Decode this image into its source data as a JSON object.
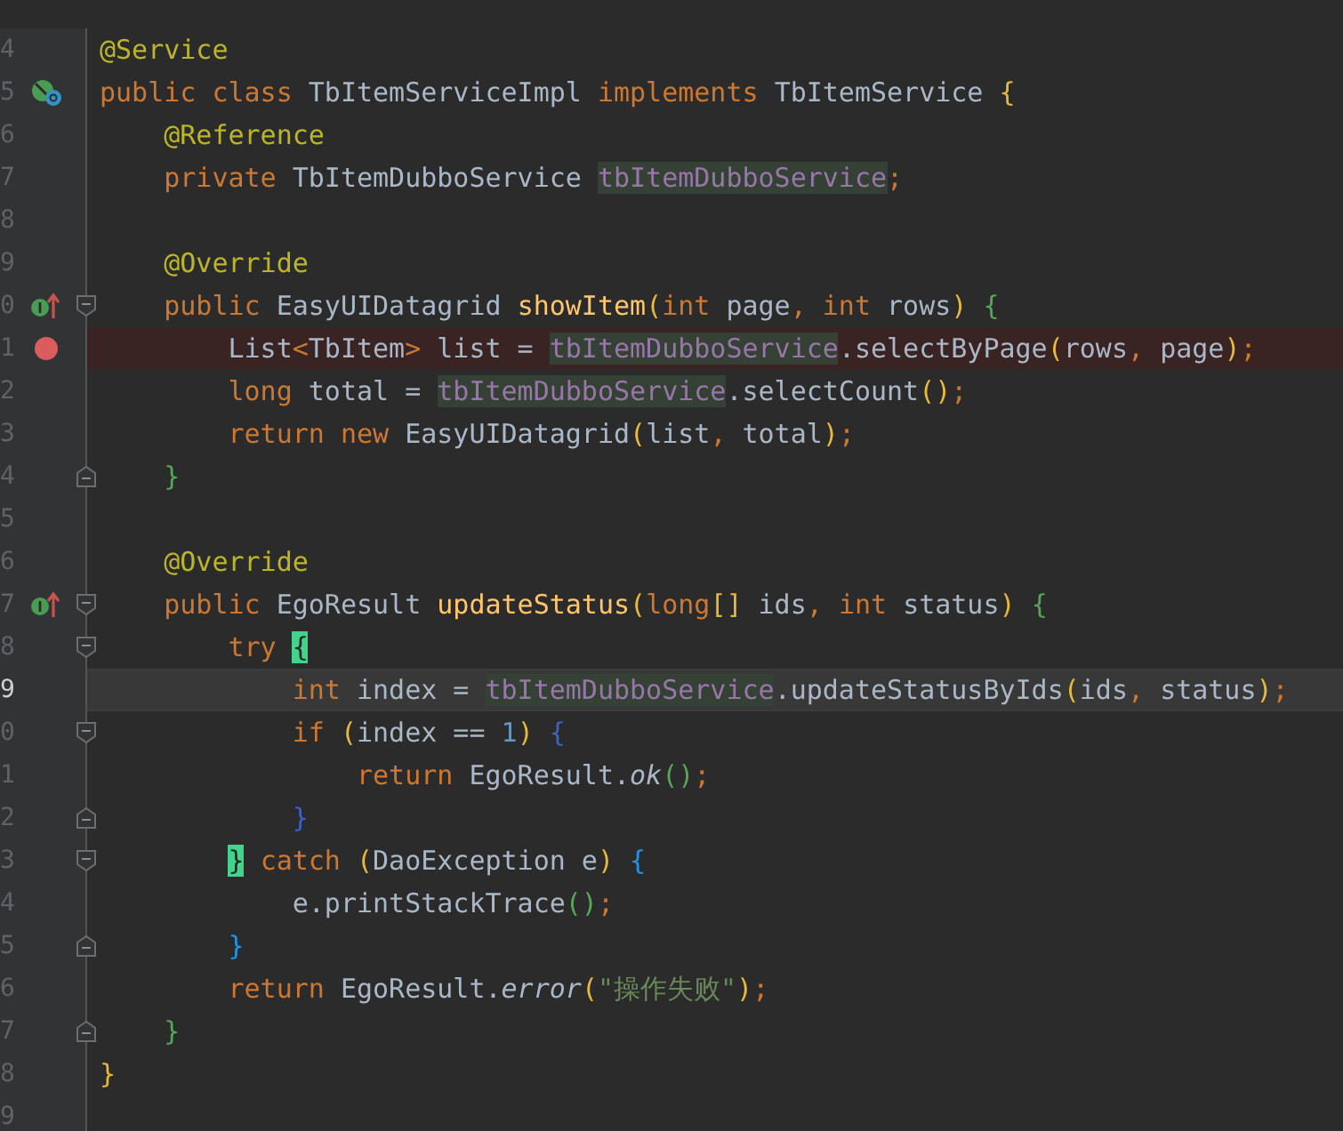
{
  "lines": [
    {
      "number": "4",
      "current": false,
      "breakpoint": false,
      "tokens": [
        {
          "kind": "annotation",
          "text": "@Service"
        }
      ]
    },
    {
      "number": "5",
      "current": false,
      "breakpoint": false,
      "marker": {
        "kind": "implements"
      },
      "tokens": [
        {
          "kind": "keyword",
          "text": "public class "
        },
        {
          "kind": "plain",
          "text": "TbItemServiceImpl "
        },
        {
          "kind": "keyword",
          "text": "implements "
        },
        {
          "kind": "plain",
          "text": "TbItemService "
        },
        {
          "kind": "bracket",
          "text": "{",
          "color": "#e8ba36"
        }
      ]
    },
    {
      "number": "6",
      "current": false,
      "breakpoint": false,
      "tokens": [
        {
          "kind": "annotation",
          "text": "    @Reference"
        }
      ]
    },
    {
      "number": "7",
      "current": false,
      "breakpoint": false,
      "tokens": [
        {
          "kind": "keyword",
          "text": "    private "
        },
        {
          "kind": "plain",
          "text": "TbItemDubboService "
        },
        {
          "kind": "usage",
          "text": "tbItemDubboService"
        },
        {
          "kind": "punct",
          "text": ";"
        }
      ]
    },
    {
      "number": "8"
    },
    {
      "number": "9",
      "current": false,
      "breakpoint": false,
      "tokens": [
        {
          "kind": "annotation",
          "text": "    @Override"
        }
      ]
    },
    {
      "number": "0",
      "current": false,
      "breakpoint": false,
      "marker": {
        "kind": "overrides"
      },
      "fold": {
        "kind": "start"
      },
      "tokens": [
        {
          "kind": "keyword",
          "text": "    public "
        },
        {
          "kind": "plain",
          "text": "EasyUIDatagrid "
        },
        {
          "kind": "method",
          "text": "showItem"
        },
        {
          "kind": "bracket",
          "text": "(",
          "color": "#e8ba36"
        },
        {
          "kind": "keyword",
          "text": "int "
        },
        {
          "kind": "plain",
          "text": "page"
        },
        {
          "kind": "punct",
          "text": ", "
        },
        {
          "kind": "keyword",
          "text": "int "
        },
        {
          "kind": "plain",
          "text": "rows"
        },
        {
          "kind": "bracket",
          "text": ")",
          "color": "#e8ba36"
        },
        {
          "kind": "bracket",
          "text": " {",
          "color": "#54a857"
        }
      ]
    },
    {
      "number": "1",
      "current": false,
      "breakpoint": true,
      "marker": {
        "kind": "breakpoint"
      },
      "tokens": [
        {
          "kind": "plain",
          "text": "        List"
        },
        {
          "kind": "keyword",
          "text": "<"
        },
        {
          "kind": "plain",
          "text": "TbItem"
        },
        {
          "kind": "keyword",
          "text": ">"
        },
        {
          "kind": "plain",
          "text": " list = "
        },
        {
          "kind": "usage",
          "text": "tbItemDubboService"
        },
        {
          "kind": "plain",
          "text": ".selectByPage"
        },
        {
          "kind": "bracket",
          "text": "(",
          "color": "#e8ba36"
        },
        {
          "kind": "plain",
          "text": "rows"
        },
        {
          "kind": "punct",
          "text": ", "
        },
        {
          "kind": "plain",
          "text": "page"
        },
        {
          "kind": "bracket",
          "text": ")",
          "color": "#e8ba36"
        },
        {
          "kind": "punct",
          "text": ";"
        }
      ]
    },
    {
      "number": "2",
      "current": false,
      "breakpoint": false,
      "tokens": [
        {
          "kind": "keyword",
          "text": "        long "
        },
        {
          "kind": "plain",
          "text": "total = "
        },
        {
          "kind": "usage",
          "text": "tbItemDubboService"
        },
        {
          "kind": "plain",
          "text": ".selectCount"
        },
        {
          "kind": "bracket",
          "text": "()",
          "color": "#e8ba36"
        },
        {
          "kind": "punct",
          "text": ";"
        }
      ]
    },
    {
      "number": "3",
      "current": false,
      "breakpoint": false,
      "tokens": [
        {
          "kind": "keyword",
          "text": "        return new "
        },
        {
          "kind": "plain",
          "text": "EasyUIDatagrid"
        },
        {
          "kind": "bracket",
          "text": "(",
          "color": "#e8ba36"
        },
        {
          "kind": "plain",
          "text": "list"
        },
        {
          "kind": "punct",
          "text": ", "
        },
        {
          "kind": "plain",
          "text": "total"
        },
        {
          "kind": "bracket",
          "text": ")",
          "color": "#e8ba36"
        },
        {
          "kind": "punct",
          "text": ";"
        }
      ]
    },
    {
      "number": "4",
      "current": false,
      "breakpoint": false,
      "fold": {
        "kind": "end"
      },
      "tokens": [
        {
          "kind": "bracket",
          "text": "    }",
          "color": "#54a857"
        }
      ]
    },
    {
      "number": "5"
    },
    {
      "number": "6",
      "current": false,
      "breakpoint": false,
      "tokens": [
        {
          "kind": "annotation",
          "text": "    @Override"
        }
      ]
    },
    {
      "number": "7",
      "current": false,
      "breakpoint": false,
      "marker": {
        "kind": "overrides"
      },
      "fold": {
        "kind": "start"
      },
      "tokens": [
        {
          "kind": "keyword",
          "text": "    public "
        },
        {
          "kind": "plain",
          "text": "EgoResult "
        },
        {
          "kind": "method",
          "text": "updateStatus"
        },
        {
          "kind": "bracket",
          "text": "(",
          "color": "#e8ba36"
        },
        {
          "kind": "keyword",
          "text": "long"
        },
        {
          "kind": "bracket",
          "text": "[]",
          "color": "#e8ba36"
        },
        {
          "kind": "plain",
          "text": " ids"
        },
        {
          "kind": "punct",
          "text": ", "
        },
        {
          "kind": "keyword",
          "text": "int "
        },
        {
          "kind": "plain",
          "text": "status"
        },
        {
          "kind": "bracket",
          "text": ")",
          "color": "#e8ba36"
        },
        {
          "kind": "bracket",
          "text": " {",
          "color": "#54a857"
        }
      ]
    },
    {
      "number": "8",
      "current": false,
      "breakpoint": false,
      "fold": {
        "kind": "start"
      },
      "tokens": [
        {
          "kind": "keyword",
          "text": "        try "
        },
        {
          "kind": "match",
          "text": "{"
        }
      ]
    },
    {
      "number": "9",
      "current": true,
      "breakpoint": false,
      "tokens": [
        {
          "kind": "keyword",
          "text": "            int "
        },
        {
          "kind": "plain",
          "text": "index = "
        },
        {
          "kind": "usage",
          "text": "tbItemDubboService"
        },
        {
          "kind": "plain",
          "text": ".updateStatusByIds"
        },
        {
          "kind": "bracket",
          "text": "(",
          "color": "#e8ba36"
        },
        {
          "kind": "plain",
          "text": "ids"
        },
        {
          "kind": "punct",
          "text": ", "
        },
        {
          "kind": "plain",
          "text": "status"
        },
        {
          "kind": "bracket",
          "text": ")",
          "color": "#e8ba36"
        },
        {
          "kind": "punct",
          "text": ";"
        }
      ]
    },
    {
      "number": "0",
      "current": false,
      "breakpoint": false,
      "fold": {
        "kind": "start"
      },
      "tokens": [
        {
          "kind": "keyword",
          "text": "            if "
        },
        {
          "kind": "bracket",
          "text": "(",
          "color": "#e8ba36"
        },
        {
          "kind": "plain",
          "text": "index == "
        },
        {
          "kind": "number",
          "text": "1"
        },
        {
          "kind": "bracket",
          "text": ")",
          "color": "#e8ba36"
        },
        {
          "kind": "bracket",
          "text": " {",
          "color": "#3d62c4"
        }
      ]
    },
    {
      "number": "1",
      "current": false,
      "breakpoint": false,
      "tokens": [
        {
          "kind": "keyword",
          "text": "                return "
        },
        {
          "kind": "plain",
          "text": "EgoResult."
        },
        {
          "kind": "static",
          "text": "ok"
        },
        {
          "kind": "bracket",
          "text": "()",
          "color": "#54a857"
        },
        {
          "kind": "punct",
          "text": ";"
        }
      ]
    },
    {
      "number": "2",
      "current": false,
      "breakpoint": false,
      "fold": {
        "kind": "end"
      },
      "tokens": [
        {
          "kind": "bracket",
          "text": "            }",
          "color": "#3d62c4"
        }
      ]
    },
    {
      "number": "3",
      "current": false,
      "breakpoint": false,
      "fold": {
        "kind": "start"
      },
      "tokens": [
        {
          "kind": "match",
          "text": "        }"
        },
        {
          "kind": "keyword",
          "text": " catch "
        },
        {
          "kind": "bracket",
          "text": "(",
          "color": "#e8ba36"
        },
        {
          "kind": "plain",
          "text": "DaoException e"
        },
        {
          "kind": "bracket",
          "text": ")",
          "color": "#e8ba36"
        },
        {
          "kind": "bracket",
          "text": " {",
          "color": "#1f94e8"
        }
      ]
    },
    {
      "number": "4",
      "current": false,
      "breakpoint": false,
      "tokens": [
        {
          "kind": "plain",
          "text": "            e.printStackTrace"
        },
        {
          "kind": "bracket",
          "text": "()",
          "color": "#54a857"
        },
        {
          "kind": "punct",
          "text": ";"
        }
      ]
    },
    {
      "number": "5",
      "current": false,
      "breakpoint": false,
      "fold": {
        "kind": "end"
      },
      "tokens": [
        {
          "kind": "bracket",
          "text": "        }",
          "color": "#1f94e8"
        }
      ]
    },
    {
      "number": "6",
      "current": false,
      "breakpoint": false,
      "tokens": [
        {
          "kind": "keyword",
          "text": "        return "
        },
        {
          "kind": "plain",
          "text": "EgoResult."
        },
        {
          "kind": "static",
          "text": "error"
        },
        {
          "kind": "bracket",
          "text": "(",
          "color": "#e8ba36"
        },
        {
          "kind": "string",
          "text": "\"操作失败\""
        },
        {
          "kind": "bracket",
          "text": ")",
          "color": "#e8ba36"
        },
        {
          "kind": "punct",
          "text": ";"
        }
      ]
    },
    {
      "number": "7",
      "current": false,
      "breakpoint": false,
      "fold": {
        "kind": "end"
      },
      "tokens": [
        {
          "kind": "bracket",
          "text": "    }",
          "color": "#54a857"
        }
      ]
    },
    {
      "number": "8",
      "current": false,
      "breakpoint": false,
      "tokens": [
        {
          "kind": "bracket",
          "text": "}",
          "color": "#e8ba36"
        }
      ]
    },
    {
      "number": "9"
    }
  ]
}
